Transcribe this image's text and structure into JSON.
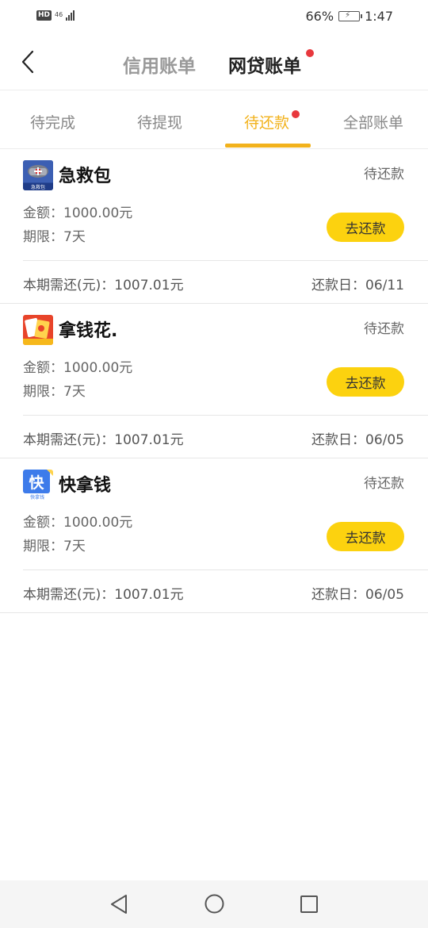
{
  "status_bar": {
    "hd": "HD",
    "network": "46",
    "battery": "66%",
    "time": "1:47"
  },
  "header": {
    "tab_credit": "信用账单",
    "tab_loan": "网贷账单"
  },
  "subtabs": [
    "待完成",
    "待提现",
    "待还款",
    "全部账单"
  ],
  "loans": [
    {
      "name": "急救包",
      "status": "待还款",
      "amount": "金额：1000.00元",
      "term": "期限：7天",
      "button": "去还款",
      "due_amount": "本期需还(元)：1007.01元",
      "due_date": "还款日：06/11"
    },
    {
      "name": "拿钱花.",
      "status": "待还款",
      "amount": "金额：1000.00元",
      "term": "期限：7天",
      "button": "去还款",
      "due_amount": "本期需还(元)：1007.01元",
      "due_date": "还款日：06/05"
    },
    {
      "name": "快拿钱",
      "status": "待还款",
      "amount": "金额：1000.00元",
      "term": "期限：7天",
      "button": "去还款",
      "due_amount": "本期需还(元)：1007.01元",
      "due_date": "还款日：06/05"
    }
  ],
  "icons": {
    "loan1": "jijiubao-app-icon",
    "loan2": "naqianhua-app-icon",
    "loan3": "kuainaqian-app-icon"
  },
  "colors": {
    "accent": "#f2b21c",
    "button": "#fcd20f",
    "badge": "#e8383d"
  }
}
